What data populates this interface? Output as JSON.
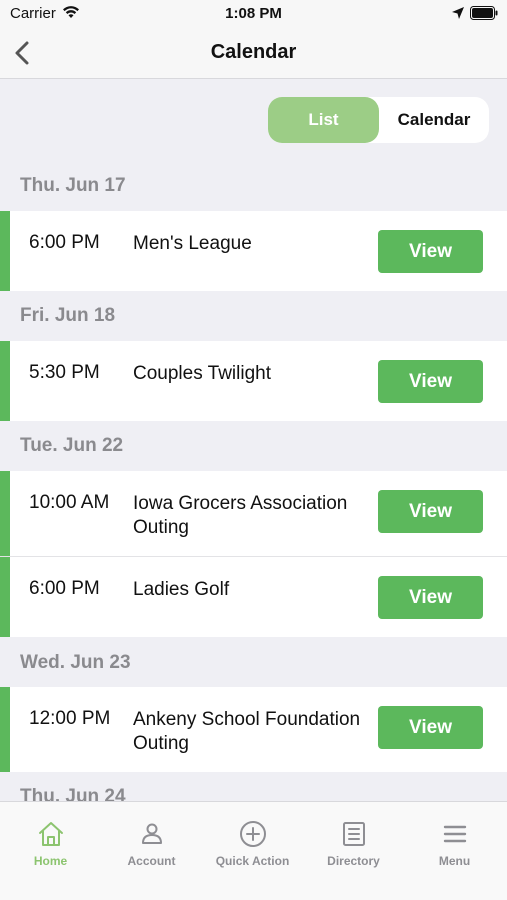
{
  "status_bar": {
    "carrier": "Carrier",
    "time": "1:08 PM"
  },
  "nav": {
    "title": "Calendar"
  },
  "segmented": {
    "options": [
      "List",
      "Calendar"
    ],
    "selected": "List"
  },
  "colors": {
    "accent": "#5cb85c",
    "segment_selected": "#9ccd86",
    "tab_active": "#8cc46f"
  },
  "sections": [
    {
      "date": "Thu. Jun 17",
      "events": [
        {
          "time": "6:00 PM",
          "title": "Men's League",
          "action": "View"
        }
      ]
    },
    {
      "date": "Fri. Jun 18",
      "events": [
        {
          "time": "5:30 PM",
          "title": "Couples Twilight",
          "action": "View"
        }
      ]
    },
    {
      "date": "Tue. Jun 22",
      "events": [
        {
          "time": "10:00 AM",
          "title": "Iowa Grocers Association Outing",
          "action": "View"
        },
        {
          "time": "6:00 PM",
          "title": "Ladies Golf",
          "action": "View"
        }
      ]
    },
    {
      "date": "Wed. Jun 23",
      "events": [
        {
          "time": "12:00 PM",
          "title": "Ankeny School Foundation Outing",
          "action": "View"
        }
      ]
    },
    {
      "date": "Thu. Jun 24",
      "events": []
    }
  ],
  "tab_bar": {
    "active": "Home",
    "tabs": [
      {
        "label": "Home",
        "icon": "home-icon"
      },
      {
        "label": "Account",
        "icon": "person-icon"
      },
      {
        "label": "Quick Action",
        "icon": "plus-circle-icon"
      },
      {
        "label": "Directory",
        "icon": "directory-icon"
      },
      {
        "label": "Menu",
        "icon": "hamburger-icon"
      }
    ]
  }
}
